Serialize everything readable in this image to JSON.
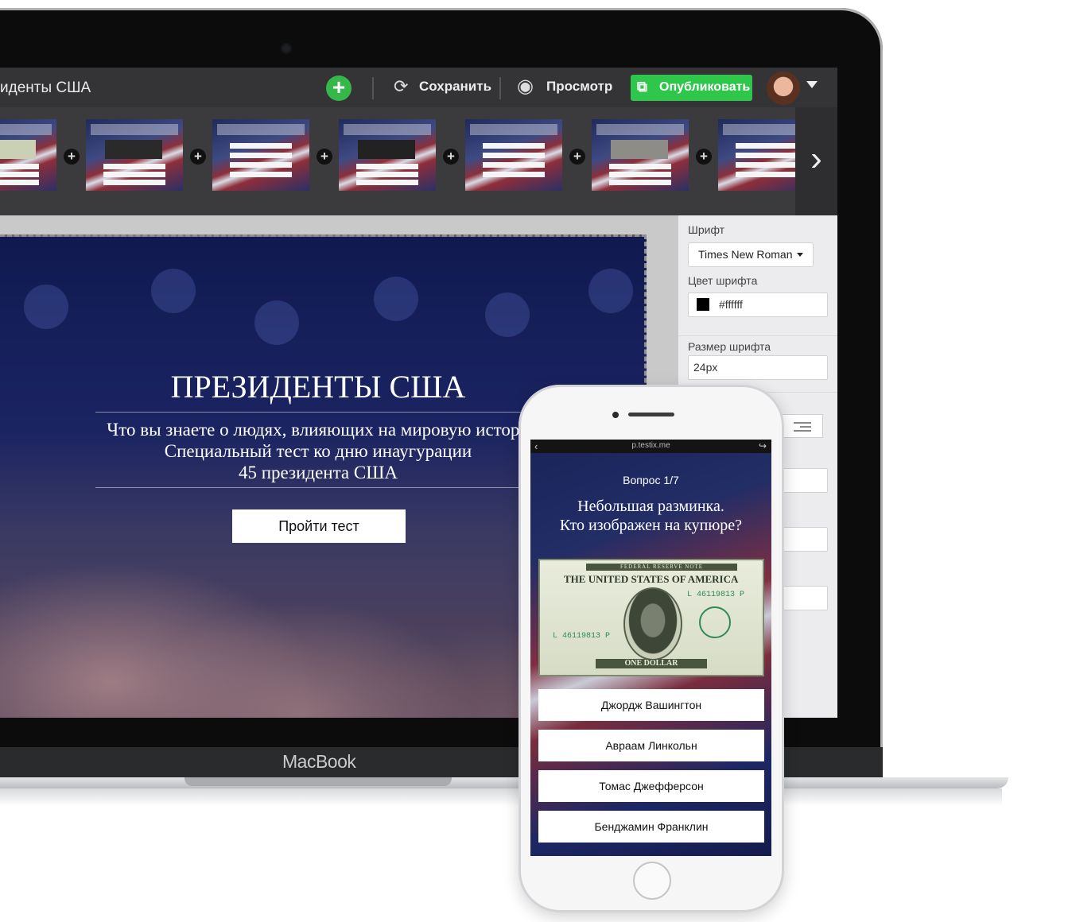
{
  "toolbar": {
    "project_title": "идeнты США",
    "add_label": "+",
    "save_label": "Сохранить",
    "preview_label": "Просмотр",
    "publish_label": "Опубликовать"
  },
  "mac_brand": "MacBook",
  "slide": {
    "title": "ПРЕЗИДЕНТЫ США",
    "subtitle_lines": [
      "Что вы знаете о людях, влияющих на мировую истори",
      "Специальный тест ко дню инаугурации",
      "45 президента США"
    ],
    "start_button": "Пройти тест"
  },
  "settings": {
    "font_label": "Шрифт",
    "font_value": "Times New Roman",
    "font_color_label": "Цвет шрифта",
    "font_color_value": "#ffffff",
    "font_size_label": "Размер шрифта",
    "font_size_value": "24px"
  },
  "phone": {
    "url": "p.testix.me",
    "question_number": "Вопрос 1/7",
    "question_lines": [
      "Небольшая разминка.",
      "Кто изображен на купюре?"
    ],
    "bill": {
      "band_text": "FEDERAL RESERVE NOTE",
      "title": "THE UNITED STATES OF AMERICA",
      "serial": "L 46119813 P",
      "bottom_text": "ONE DOLLAR"
    },
    "options": [
      "Джордж Вашингтон",
      "Авраам Линкольн",
      "Томас Джефферсон",
      "Бенджамин Франклин"
    ]
  },
  "colors": {
    "accent_green": "#2fc74b",
    "toolbar_bg": "#343436",
    "slide_bg": "#1b2462"
  }
}
